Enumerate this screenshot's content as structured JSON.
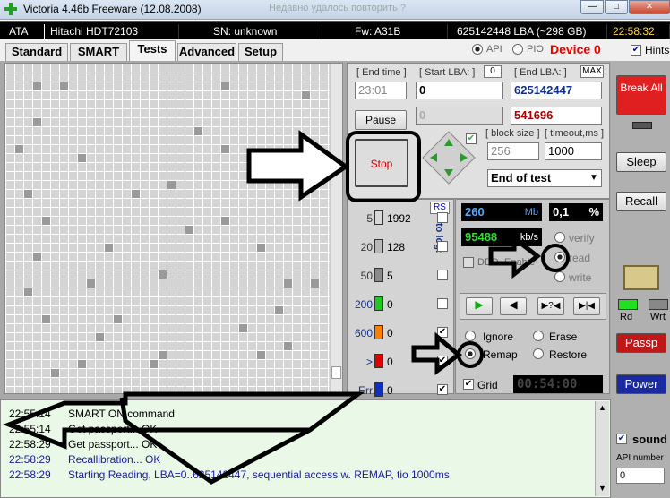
{
  "window": {
    "title": "Victoria 4.46b Freeware (12.08.2008)",
    "bg_title": "Недавно удалось повторить ?",
    "minimize": "—",
    "maximize": "□",
    "close": "✕"
  },
  "infobar": {
    "iface": "ATA",
    "model": "Hitachi HDT72103",
    "serial": "SN: unknown",
    "firmware": "Fw: A31B",
    "capacity": "625142448 LBA (~298 GB)",
    "clock": "22:58:32"
  },
  "tabs": [
    "Standard",
    "SMART",
    "Tests",
    "Advanced",
    "Setup"
  ],
  "api": {
    "api_label": "API",
    "pio_label": "PIO",
    "device": "Device 0",
    "hints": "Hints"
  },
  "controls": {
    "end_time_label": "[ End time ]",
    "end_time": "23:01",
    "start_lba_label": "[ Start LBA: ]",
    "start_lba_badge": "0",
    "start_lba": "0",
    "end_lba_label": "[ End LBA: ]",
    "end_lba_badge": "MAX",
    "end_lba": "625142447",
    "pause": "Pause",
    "cur_lba": "0",
    "remain": "541696",
    "stop": "Stop",
    "block_size_label": "[ block size ]",
    "block_size": "256",
    "timeout_label": "[ timeout,ms ]",
    "timeout": "1000",
    "end_action": "End of test"
  },
  "stats": {
    "rs": "RS",
    "to_log": "to log:",
    "rows": [
      {
        "label": "5",
        "count": "1992",
        "color": "#d8d8d8",
        "checked": false
      },
      {
        "label": "20",
        "count": "128",
        "color": "#b8b8b8",
        "checked": false
      },
      {
        "label": "50",
        "count": "5",
        "color": "#8a8a8a",
        "checked": false
      },
      {
        "label": "200",
        "count": "0",
        "color": "#21c821",
        "checked": false
      },
      {
        "label": "600",
        "count": "0",
        "color": "#ff8000",
        "checked": true
      },
      {
        "label": ">",
        "count": "0",
        "color": "#e00000",
        "checked": true
      },
      {
        "label": "Err",
        "count": "0",
        "color": "#1030c0",
        "checked": true
      }
    ]
  },
  "speed": {
    "mb": "260",
    "mb_unit": "Mb",
    "pct": "0,1",
    "pct_unit": "%",
    "kbs": "95488",
    "kbs_unit": "kb/s",
    "ddd": "DDD",
    "enable": "Enable",
    "verify": "verify",
    "read": "read",
    "write": "write"
  },
  "modes": {
    "ignore": "Ignore",
    "erase": "Erase",
    "remap": "Remap",
    "restore": "Restore",
    "grid": "Grid",
    "timer": "00:54:00"
  },
  "sidebar": {
    "break_all": "Break All",
    "sleep": "Sleep",
    "recall": "Recall",
    "rd": "Rd",
    "wrt": "Wrt",
    "passp": "Passp",
    "power": "Power",
    "sound": "sound",
    "api_number_label": "API number",
    "api_number": "0"
  },
  "log": [
    {
      "time": "22:55:14",
      "msg": "SMART ON command",
      "color": "#000"
    },
    {
      "time": "22:55:14",
      "msg": "Get passport... OK",
      "color": "#000"
    },
    {
      "time": "22:58:29",
      "msg": "Get passport... OK",
      "color": "#000"
    },
    {
      "time": "22:58:29",
      "msg": "Recallibration... OK",
      "color": "#1a1aa0"
    },
    {
      "time": "22:58:29",
      "msg": "Starting Reading, LBA=0..625142447, sequential access w. REMAP, tio 1000ms",
      "color": "#1a1aa0"
    }
  ]
}
